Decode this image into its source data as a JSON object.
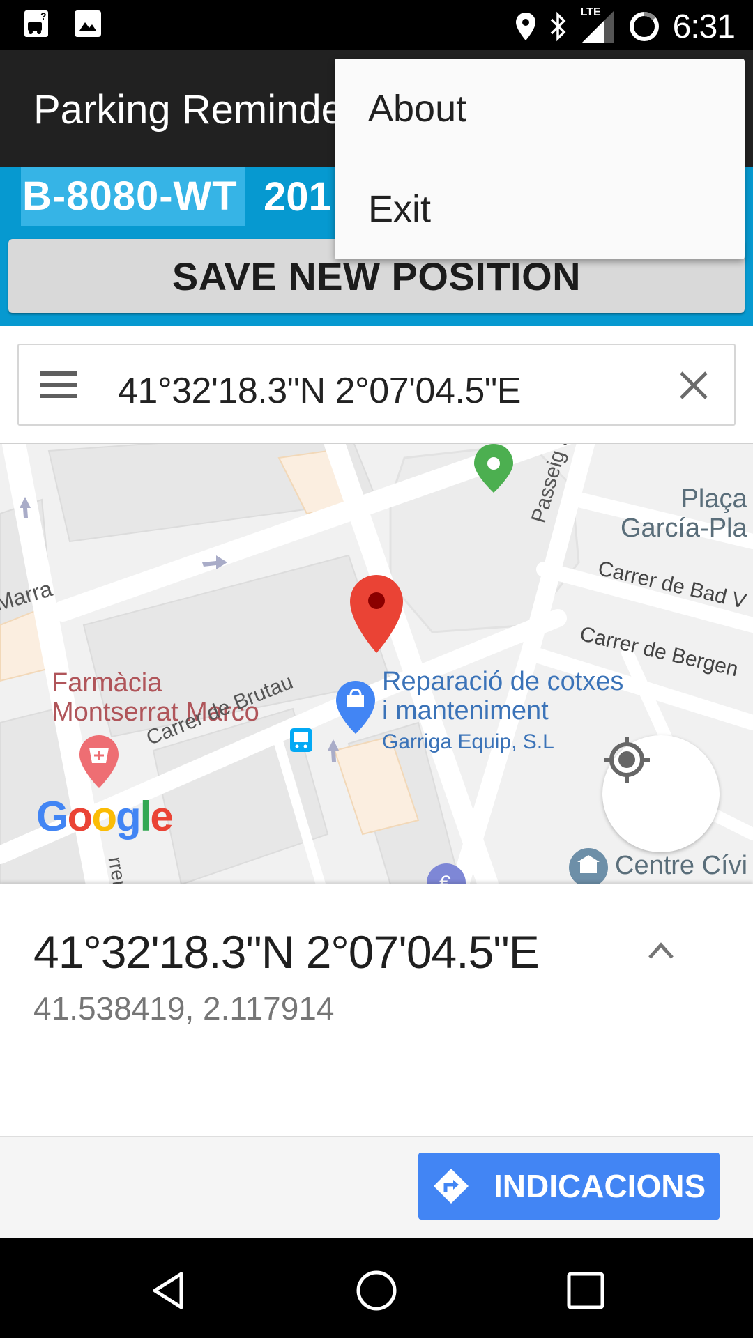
{
  "status_bar": {
    "time": "6:31",
    "network": "LTE",
    "left_icons": [
      "parking-app-notification-icon",
      "image-notification-icon"
    ],
    "right_icons": [
      "location-icon",
      "bluetooth-icon",
      "lte-signal-icon",
      "battery-icon"
    ]
  },
  "app_bar": {
    "title": "Parking Reminder"
  },
  "panel": {
    "plate": "B-8080-WT",
    "date_partial": "201",
    "save_button": "SAVE NEW POSITION"
  },
  "overflow_menu": {
    "items": [
      {
        "label": "About"
      },
      {
        "label": "Exit"
      }
    ]
  },
  "maps": {
    "search_value": "41°32'18.3\"N 2°07'04.5\"E",
    "map_labels": {
      "marra": "Marra",
      "pharmacy_line1": "Farmàcia",
      "pharmacy_line2": "Montserrat Marco",
      "repair_line1": "Reparació de cotxes",
      "repair_line2": "i manteniment",
      "repair_sub": "Garriga Equip, S.L",
      "carrer_brutau": "Carrer de Brutau",
      "passeig": "Passeig Sant C",
      "placa_line1": "Plaça",
      "placa_line2": "García-Pla",
      "carrer_bad": "Carrer de Bad V",
      "carrer_bergen": "Carrer de Bergen",
      "centre_civic": "Centre Cívi",
      "carrer_bottom": "rrer"
    },
    "google_logo": [
      "G",
      "o",
      "o",
      "g",
      "l",
      "e"
    ],
    "place": {
      "dms": "41°32'18.3\"N 2°07'04.5\"E",
      "decimal": "41.538419, 2.117914"
    },
    "directions_button": "INDICACIONS"
  },
  "colors": {
    "app_bar": "#212121",
    "panel_blue": "#0699d0",
    "plate_highlight": "#36b4e6",
    "directions_blue": "#4285f4",
    "marker_red": "#ea4335",
    "marker_green": "#4caf50",
    "pharmacy_text": "#b0555a",
    "business_text": "#3b73b8"
  },
  "nav_bar": {
    "buttons": [
      "back",
      "home",
      "recents"
    ]
  }
}
